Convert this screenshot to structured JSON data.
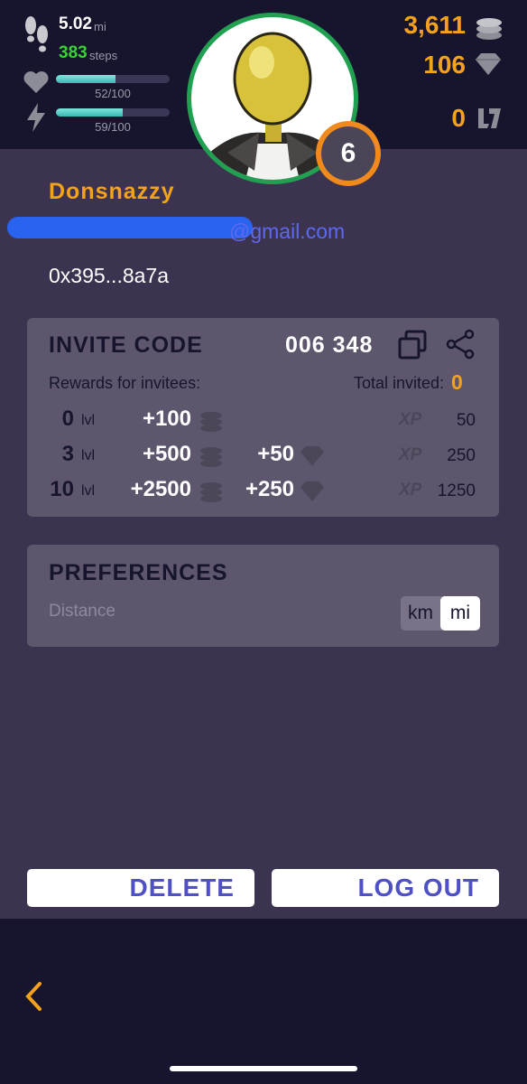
{
  "stats": {
    "distance_value": "5.02",
    "distance_unit": "mi",
    "steps_value": "383",
    "steps_unit": "steps",
    "health_text": "52/100",
    "health_fraction": 0.52,
    "energy_text": "59/100",
    "energy_fraction": 0.59
  },
  "currency": {
    "coins": "3,611",
    "gems": "106",
    "tokens": "0"
  },
  "avatar": {
    "level": "6"
  },
  "profile": {
    "username": "Donsnazzy",
    "email_visible": "@gmail.com",
    "wallet": "0x395...8a7a"
  },
  "invite": {
    "title": "INVITE CODE",
    "code": "006 348",
    "rewards_label": "Rewards for invitees:",
    "total_label": "Total invited:",
    "total_value": "0",
    "rows": [
      {
        "level": "0",
        "lvl": "lvl",
        "coins": "+100",
        "gems": "",
        "xp": "50"
      },
      {
        "level": "3",
        "lvl": "lvl",
        "coins": "+500",
        "gems": "+50",
        "xp": "250"
      },
      {
        "level": "10",
        "lvl": "lvl",
        "coins": "+2500",
        "gems": "+250",
        "xp": "1250"
      }
    ],
    "xp_label": "XP"
  },
  "preferences": {
    "title": "PREFERENCES",
    "distance_label": "Distance",
    "options": [
      "km",
      "mi"
    ],
    "selected": "mi"
  },
  "buttons": {
    "delete": "DELETE",
    "logout": "LOG OUT"
  },
  "colors": {
    "accent_gold": "#f4a21c",
    "steps_green": "#36d52f",
    "button_text": "#4f4fc6",
    "background": "#3c3350",
    "header": "#17152e"
  }
}
